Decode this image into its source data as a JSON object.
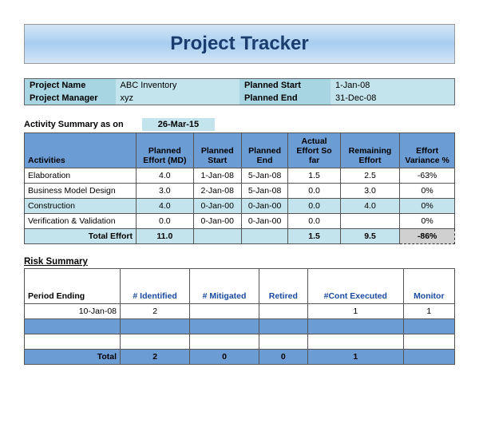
{
  "title": "Project Tracker",
  "info": {
    "name_label": "Project Name",
    "name_value": "ABC Inventory",
    "manager_label": "Project Manager",
    "manager_value": "xyz",
    "planned_start_label": "Planned Start",
    "planned_start_value": "1-Jan-08",
    "planned_end_label": "Planned End",
    "planned_end_value": "31-Dec-08"
  },
  "activity_summary": {
    "heading": "Activity Summary as on",
    "date": "26-Mar-15",
    "headers": {
      "activities": "Activities",
      "planned_effort": "Planned Effort (MD)",
      "planned_start": "Planned Start",
      "planned_end": "Planned End",
      "actual_effort": "Actual Effort So far",
      "remaining": "Remaining Effort",
      "variance": "Effort Variance %"
    },
    "rows": [
      {
        "act": "Elaboration",
        "pe": "4.0",
        "ps": "1-Jan-08",
        "pend": "5-Jan-08",
        "ae": "1.5",
        "re": "2.5",
        "ev": "-63%"
      },
      {
        "act": "Business Model Design",
        "pe": "3.0",
        "ps": "2-Jan-08",
        "pend": "5-Jan-08",
        "ae": "0.0",
        "re": "3.0",
        "ev": "0%"
      },
      {
        "act": "Construction",
        "pe": "4.0",
        "ps": "0-Jan-00",
        "pend": "0-Jan-00",
        "ae": "0.0",
        "re": "4.0",
        "ev": "0%"
      },
      {
        "act": "Verification & Validation",
        "pe": "0.0",
        "ps": "0-Jan-00",
        "pend": "0-Jan-00",
        "ae": "0.0",
        "re": "",
        "ev": "0%"
      }
    ],
    "total": {
      "label": "Total Effort",
      "pe": "11.0",
      "ae": "1.5",
      "re": "9.5",
      "ev": "-86%"
    }
  },
  "risk_summary": {
    "heading": "Risk Summary",
    "headers": {
      "period": "Period Ending",
      "identified": "# Identified",
      "mitigated": "# Mitigated",
      "retired": "Retired",
      "cont": "#Cont Executed",
      "monitor": "Monitor"
    },
    "rows": [
      {
        "period": "10-Jan-08",
        "id": "2",
        "mit": "",
        "ret": "",
        "cont": "1",
        "mon": "1"
      }
    ],
    "total": {
      "label": "Total",
      "id": "2",
      "mit": "0",
      "ret": "0",
      "cont": "1",
      "mon": ""
    }
  },
  "chart_data": [
    {
      "type": "table",
      "title": "Activity Summary",
      "columns": [
        "Activities",
        "Planned Effort (MD)",
        "Planned Start",
        "Planned End",
        "Actual Effort So far",
        "Remaining Effort",
        "Effort Variance %"
      ],
      "rows": [
        [
          "Elaboration",
          4.0,
          "1-Jan-08",
          "5-Jan-08",
          1.5,
          2.5,
          "-63%"
        ],
        [
          "Business Model Design",
          3.0,
          "2-Jan-08",
          "5-Jan-08",
          0.0,
          3.0,
          "0%"
        ],
        [
          "Construction",
          4.0,
          "0-Jan-00",
          "0-Jan-00",
          0.0,
          4.0,
          "0%"
        ],
        [
          "Verification & Validation",
          0.0,
          "0-Jan-00",
          "0-Jan-00",
          0.0,
          null,
          "0%"
        ],
        [
          "Total Effort",
          11.0,
          null,
          null,
          1.5,
          9.5,
          "-86%"
        ]
      ]
    },
    {
      "type": "table",
      "title": "Risk Summary",
      "columns": [
        "Period Ending",
        "# Identified",
        "# Mitigated",
        "Retired",
        "#Cont Executed",
        "Monitor"
      ],
      "rows": [
        [
          "10-Jan-08",
          2,
          null,
          null,
          1,
          1
        ],
        [
          "Total",
          2,
          0,
          0,
          1,
          null
        ]
      ]
    }
  ]
}
